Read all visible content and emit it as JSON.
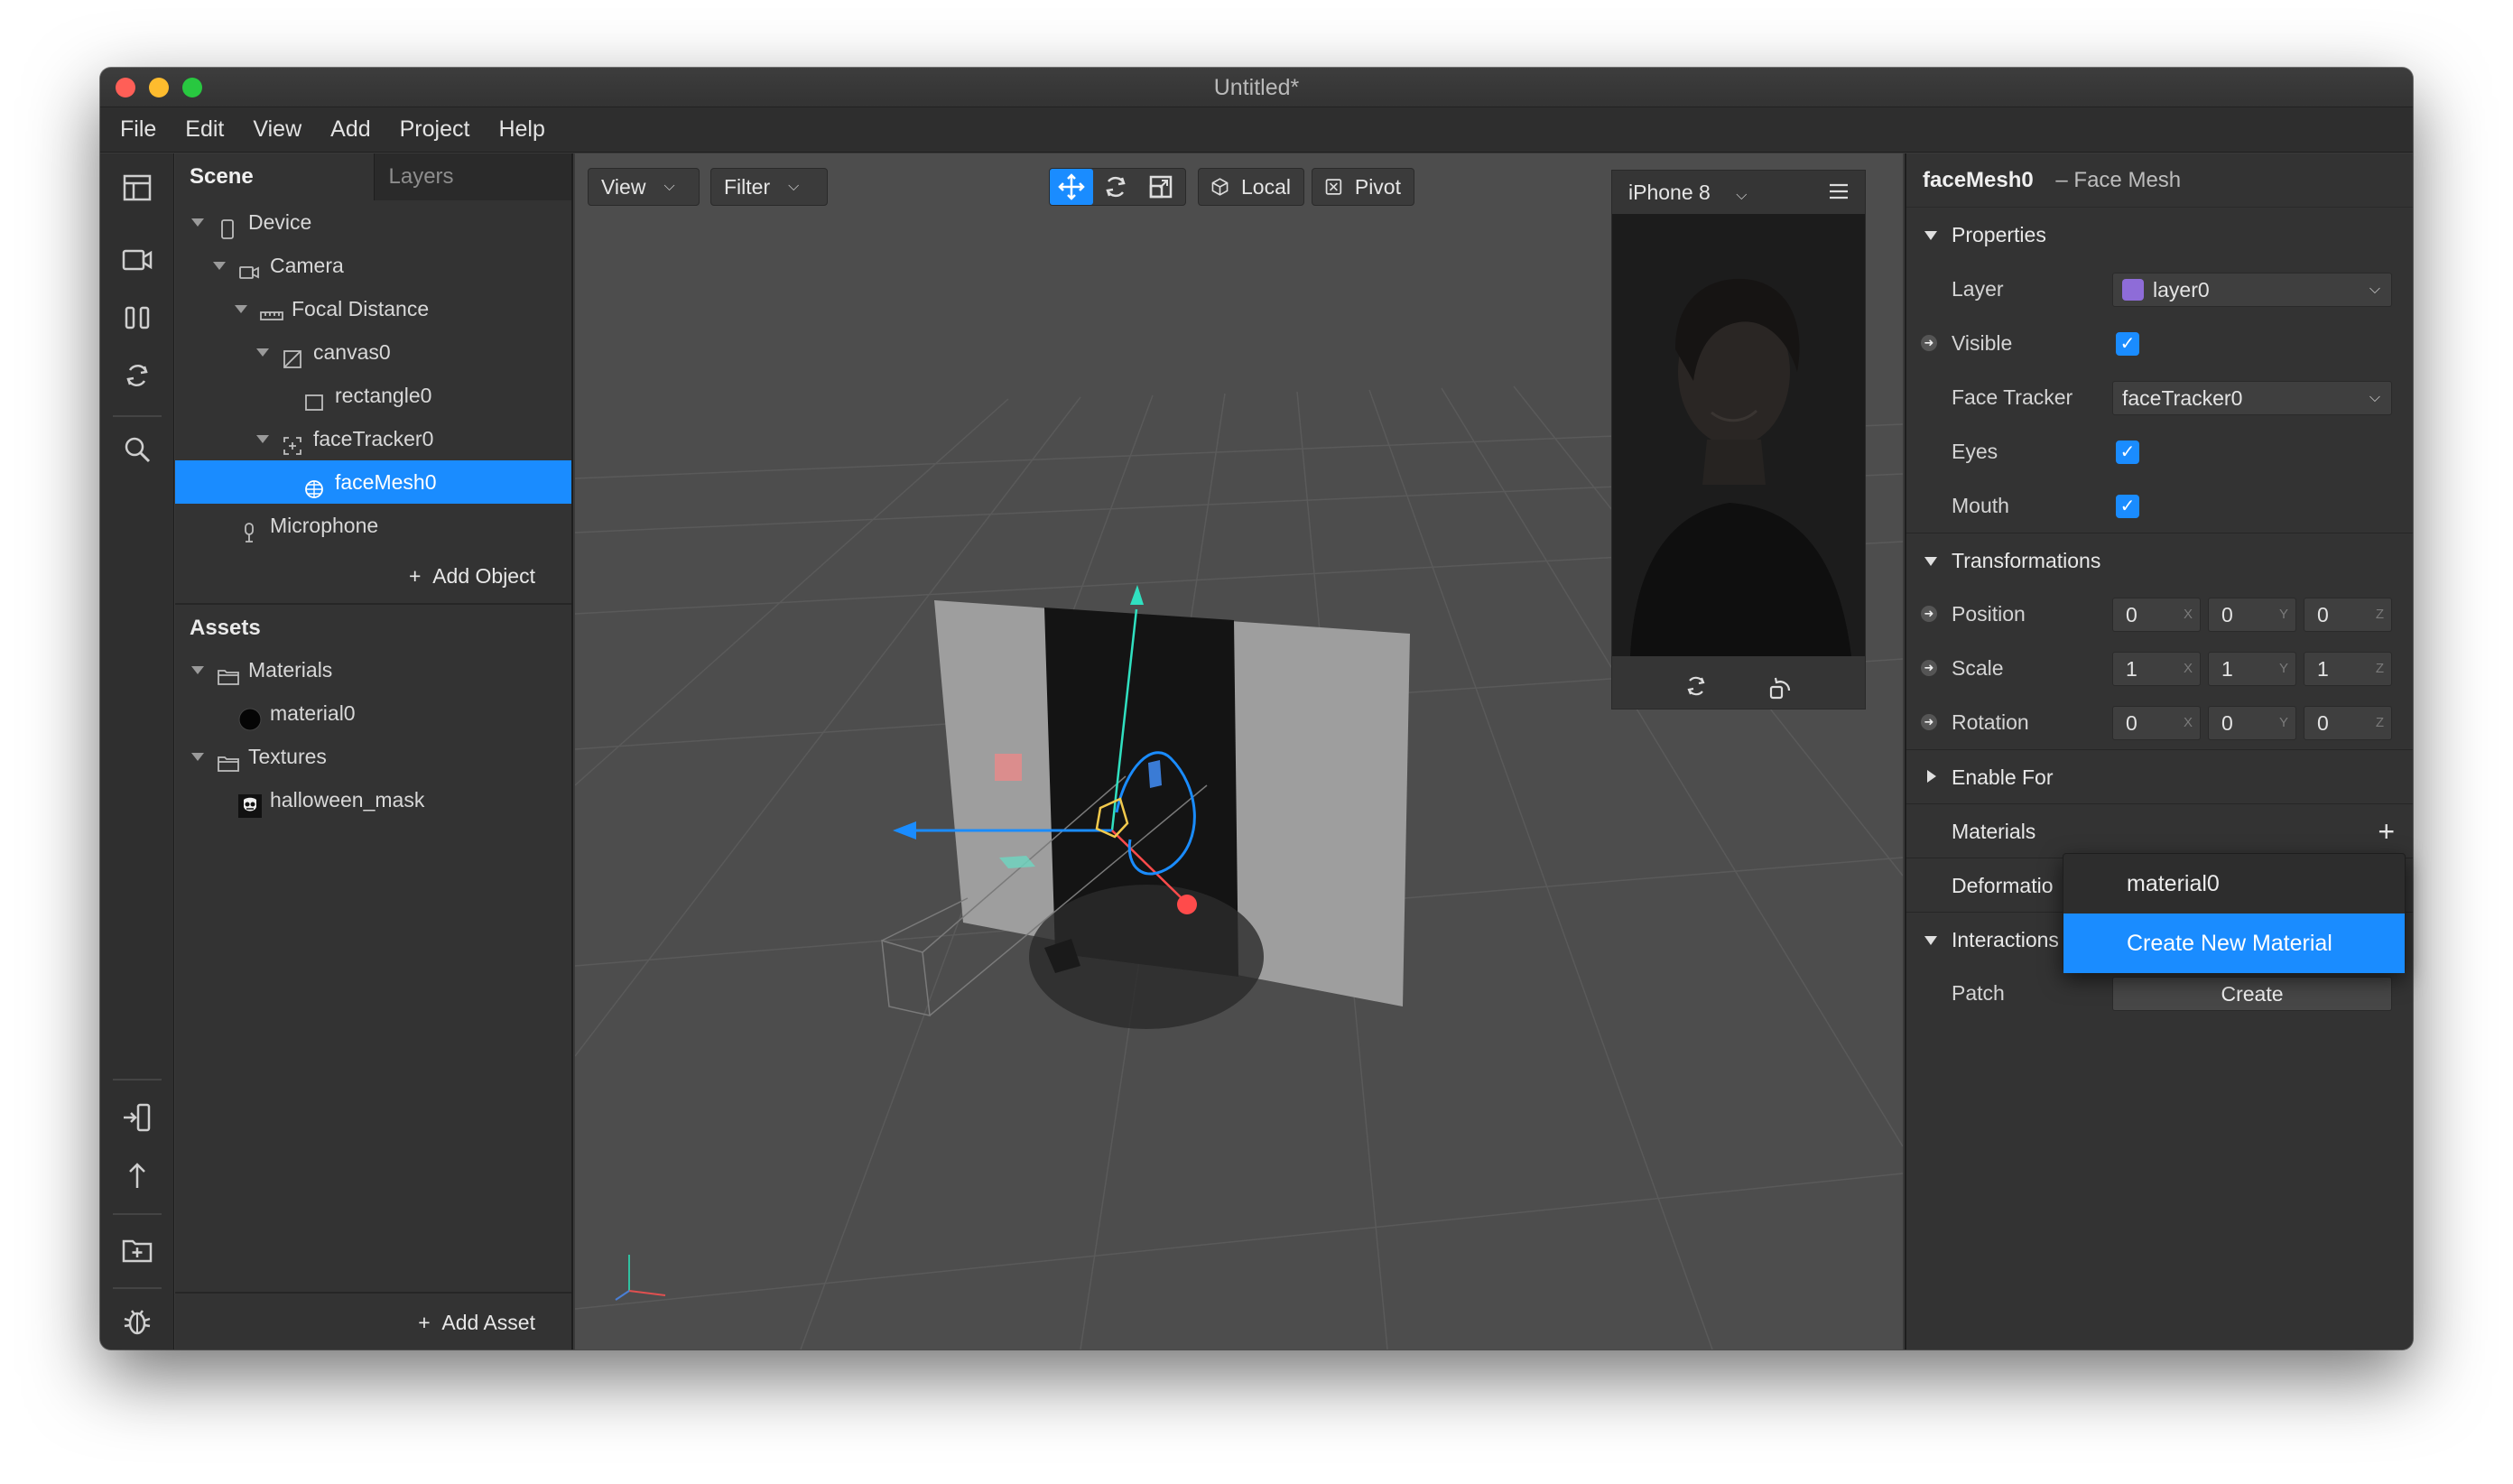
{
  "window": {
    "title": "Untitled*"
  },
  "menu": [
    "File",
    "Edit",
    "View",
    "Add",
    "Project",
    "Help"
  ],
  "scene_panel": {
    "tabs": [
      "Scene",
      "Layers"
    ],
    "tree": [
      {
        "label": "Device",
        "depth": 0,
        "expanded": true,
        "icon": "phone-icon"
      },
      {
        "label": "Camera",
        "depth": 1,
        "expanded": true,
        "icon": "camera-icon"
      },
      {
        "label": "Focal Distance",
        "depth": 2,
        "expanded": true,
        "icon": "ruler-icon"
      },
      {
        "label": "canvas0",
        "depth": 3,
        "expanded": true,
        "icon": "canvas-icon"
      },
      {
        "label": "rectangle0",
        "depth": 4,
        "expanded": null,
        "icon": "rectangle-icon"
      },
      {
        "label": "faceTracker0",
        "depth": 3,
        "expanded": true,
        "icon": "face-tracker-icon"
      },
      {
        "label": "faceMesh0",
        "depth": 4,
        "expanded": null,
        "icon": "face-mesh-icon",
        "selected": true
      },
      {
        "label": "Microphone",
        "depth": 1,
        "expanded": null,
        "icon": "microphone-icon"
      }
    ],
    "add_object": "Add Object",
    "assets_title": "Assets",
    "assets": [
      {
        "label": "Materials",
        "depth": 0,
        "expanded": true,
        "icon": "folder-icon"
      },
      {
        "label": "material0",
        "depth": 1,
        "expanded": null,
        "icon": "material-swatch-icon"
      },
      {
        "label": "Textures",
        "depth": 0,
        "expanded": true,
        "icon": "folder-icon"
      },
      {
        "label": "halloween_mask",
        "depth": 1,
        "expanded": null,
        "icon": "texture-thumbnail-icon"
      }
    ],
    "add_asset": "Add Asset"
  },
  "viewport": {
    "view_label": "View",
    "filter_label": "Filter",
    "local_label": "Local",
    "pivot_label": "Pivot",
    "device_label": "iPhone 8"
  },
  "properties": {
    "object_name": "faceMesh0",
    "object_type": "– Face Mesh",
    "sections": {
      "properties": "Properties",
      "transformations": "Transformations",
      "enable_for": "Enable For",
      "materials": "Materials",
      "deformation": "Deformatio",
      "interactions": "Interactions"
    },
    "layer_label": "Layer",
    "layer_value": "layer0",
    "layer_color": "#8e6cd8",
    "visible_label": "Visible",
    "face_tracker_label": "Face Tracker",
    "face_tracker_value": "faceTracker0",
    "eyes_label": "Eyes",
    "mouth_label": "Mouth",
    "position_label": "Position",
    "position": [
      "0",
      "0",
      "0"
    ],
    "scale_label": "Scale",
    "scale": [
      "1",
      "1",
      "1"
    ],
    "rotation_label": "Rotation",
    "rotation": [
      "0",
      "0",
      "0"
    ],
    "axes": [
      "X",
      "Y",
      "Z"
    ],
    "patch_label": "Patch",
    "create_label": "Create"
  },
  "material_dropdown": {
    "items": [
      "material0",
      "Create New Material"
    ],
    "highlighted": 1
  },
  "colors": {
    "accent": "#1a8cff"
  }
}
